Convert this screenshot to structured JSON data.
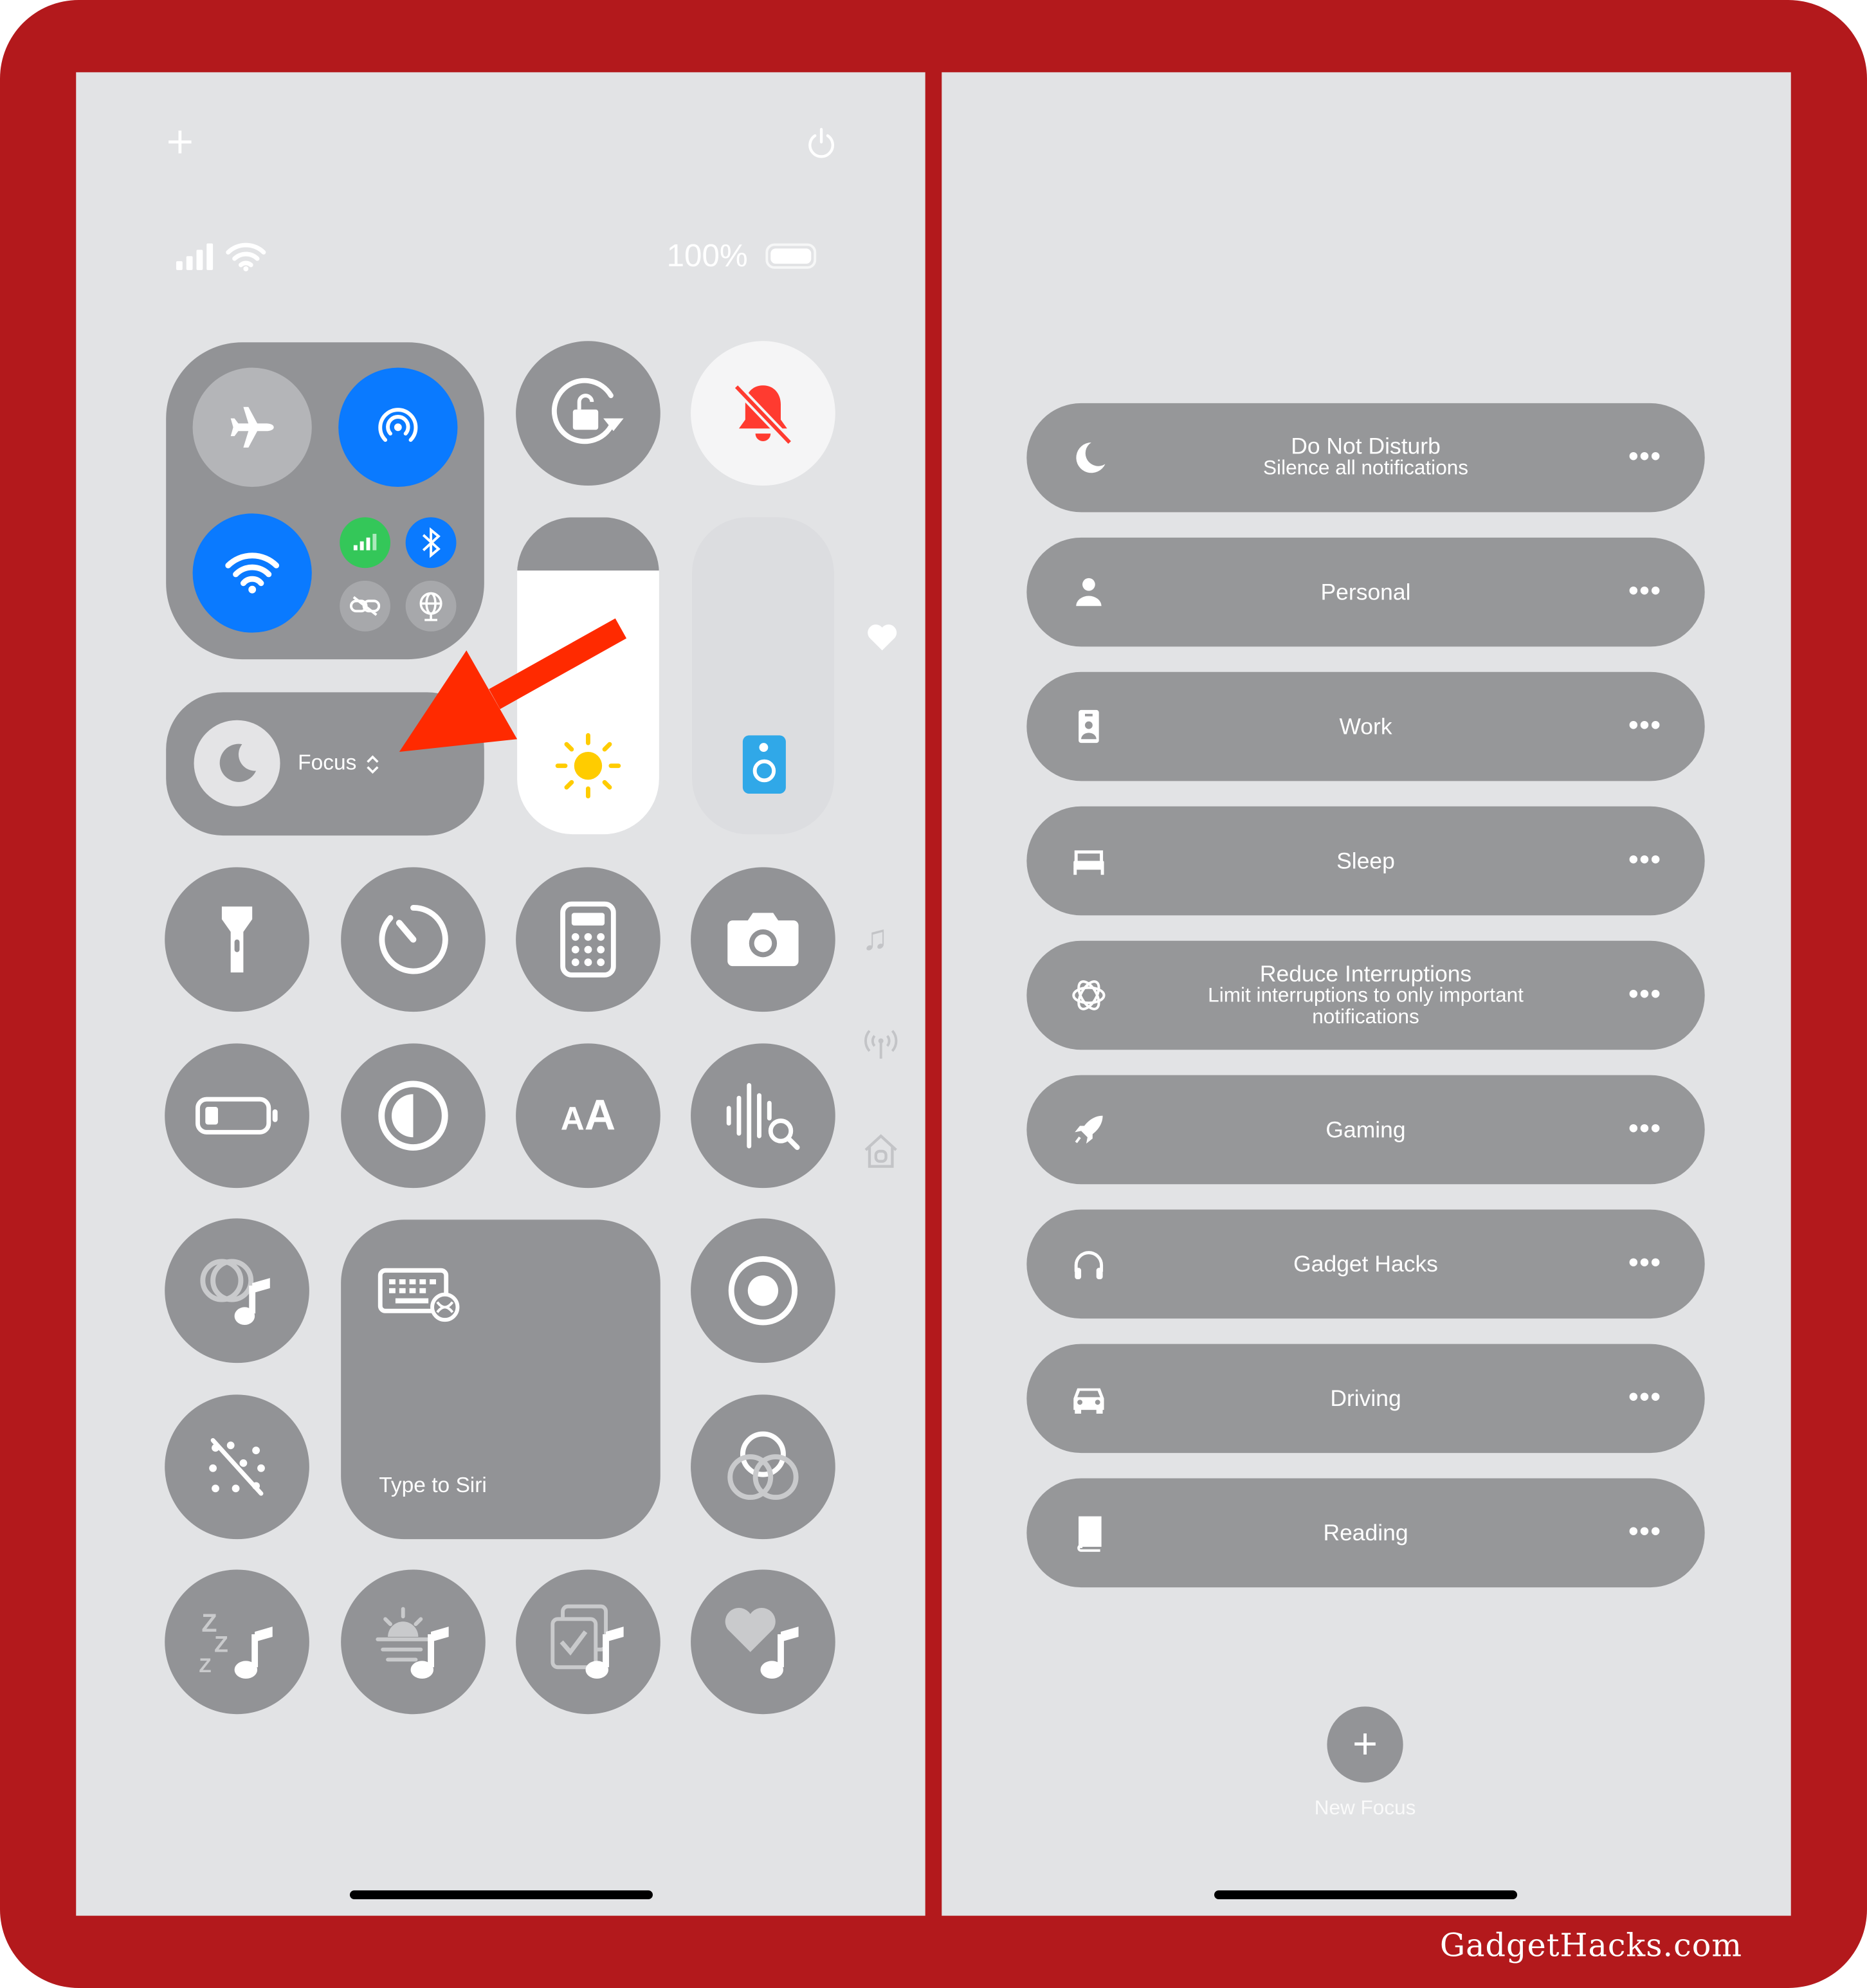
{
  "left_screen": {
    "top_add_icon": "plus-icon",
    "top_power_icon": "power-icon",
    "status": {
      "battery_percent": "100%",
      "battery_level": 1.0
    },
    "connectivity": {
      "airplane": false,
      "airdrop": true,
      "wifi": true,
      "cellular": true,
      "bluetooth": true
    },
    "focus": {
      "label": "Focus",
      "chevron": "⌃⌄"
    },
    "brightness_level": 0.83,
    "volume_level": 0.0,
    "type_to_siri": "Type to Siri",
    "colors": {
      "accent_blue": "#0a7aff",
      "cellular_green": "#34c759",
      "bell_red": "#ff3b30",
      "arrow_red": "#ff2a00",
      "frame_red": "#b3191c"
    }
  },
  "right_screen": {
    "focus_modes": [
      {
        "title": "Do Not Disturb",
        "subtitle": "Silence all notifications",
        "icon": "moon-icon"
      },
      {
        "title": "Personal",
        "subtitle": "",
        "icon": "person-icon"
      },
      {
        "title": "Work",
        "subtitle": "",
        "icon": "id-badge-icon"
      },
      {
        "title": "Sleep",
        "subtitle": "",
        "icon": "bed-icon"
      },
      {
        "title": "Reduce Interruptions",
        "subtitle": "Limit interruptions to only important notifications",
        "icon": "intelligence-icon"
      },
      {
        "title": "Gaming",
        "subtitle": "",
        "icon": "rocket-icon"
      },
      {
        "title": "Gadget Hacks",
        "subtitle": "",
        "icon": "headphones-icon"
      },
      {
        "title": "Driving",
        "subtitle": "",
        "icon": "car-icon"
      },
      {
        "title": "Reading",
        "subtitle": "",
        "icon": "book-icon"
      }
    ],
    "more_label": "•••",
    "new_focus_label": "New Focus",
    "new_focus_glyph": "+"
  },
  "watermark": "GadgetHacks.com"
}
